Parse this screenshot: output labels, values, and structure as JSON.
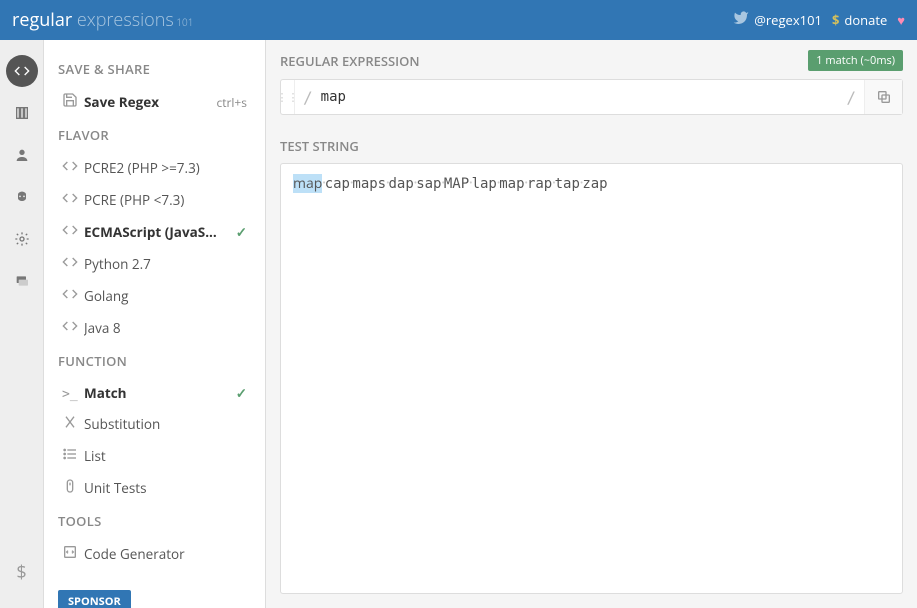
{
  "header": {
    "logo1": "regular",
    "logo2": " expressions",
    "logo3": " 101",
    "twitter": "@regex101",
    "donate": "donate"
  },
  "sidebar": {
    "save_share": "SAVE & SHARE",
    "save_regex": "Save Regex",
    "save_shortcut": "ctrl+s",
    "flavor": "FLAVOR",
    "flavors": [
      "PCRE2 (PHP >=7.3)",
      "PCRE (PHP <7.3)",
      "ECMAScript (JavaS...",
      "Python 2.7",
      "Golang",
      "Java 8"
    ],
    "function": "FUNCTION",
    "functions": [
      "Match",
      "Substitution",
      "List",
      "Unit Tests"
    ],
    "tools": "TOOLS",
    "codegen": "Code Generator",
    "sponsor": "SPONSOR"
  },
  "main": {
    "re_title": "REGULAR EXPRESSION",
    "badge": "1 match (~0ms)",
    "regex_value": "map",
    "ts_title": "TEST STRING",
    "words": [
      "map",
      "cap",
      "maps",
      "dap",
      "sap",
      "MAP",
      "lap",
      "map",
      "rap",
      "tap",
      "zap"
    ]
  }
}
